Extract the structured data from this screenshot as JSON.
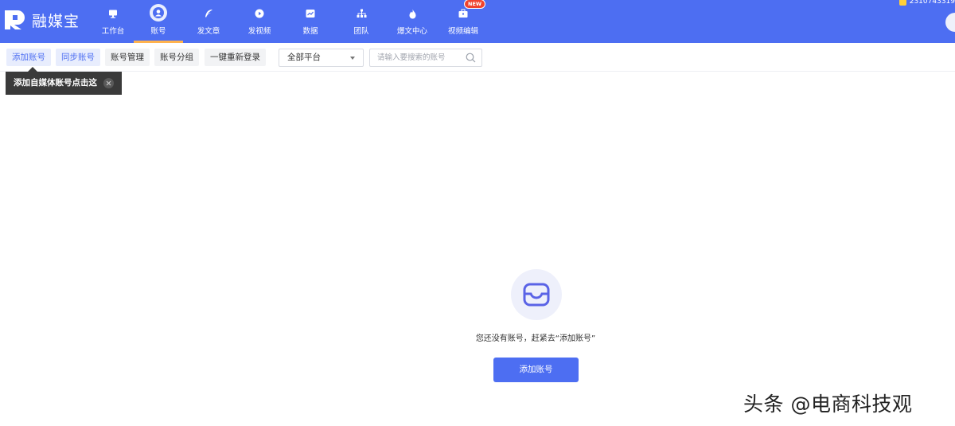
{
  "app": {
    "name": "融媒宝",
    "accent_color": "#4d6ef2",
    "user_id": "2310743319"
  },
  "nav": {
    "items": [
      {
        "label": "工作台",
        "icon": "monitor-icon"
      },
      {
        "label": "账号",
        "icon": "user-icon",
        "active": true
      },
      {
        "label": "发文章",
        "icon": "feather-icon"
      },
      {
        "label": "发视频",
        "icon": "play-icon"
      },
      {
        "label": "数据",
        "icon": "chart-icon"
      },
      {
        "label": "团队",
        "icon": "team-icon"
      },
      {
        "label": "爆文中心",
        "icon": "fire-icon"
      },
      {
        "label": "视频编辑",
        "icon": "toolbox-icon",
        "badge": "NEW"
      }
    ]
  },
  "toolbar": {
    "add_account": "添加账号",
    "sync_account": "同步账号",
    "manage_account": "账号管理",
    "group_account": "账号分组",
    "relogin_all": "一键重新登录",
    "platform_select": "全部平台",
    "search_placeholder": "请输入要搜索的账号"
  },
  "tooltip": {
    "text": "添加自媒体账号点击这"
  },
  "empty_state": {
    "icon": "inbox-icon",
    "message": "您还没有账号，赶紧去“添加账号”",
    "button": "添加账号"
  },
  "watermark": {
    "text": "头条 @电商科技观"
  }
}
